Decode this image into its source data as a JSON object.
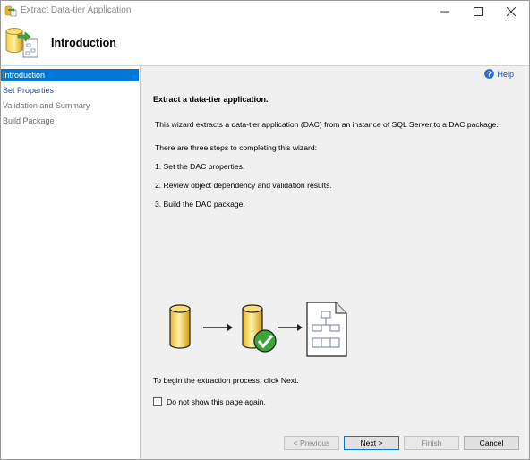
{
  "window": {
    "title": "Extract Data-tier Application"
  },
  "header": {
    "title": "Introduction"
  },
  "nav": {
    "items": [
      {
        "label": "Introduction"
      },
      {
        "label": "Set Properties"
      },
      {
        "label": "Validation and Summary"
      },
      {
        "label": "Build Package"
      }
    ]
  },
  "content": {
    "help_label": "Help",
    "heading": "Extract a data-tier application.",
    "description": "This wizard extracts a data-tier application (DAC) from an instance of SQL Server to a DAC package.",
    "steps_intro": "There are three steps to completing this wizard:",
    "steps": [
      "1. Set the DAC properties.",
      "2. Review object dependency and validation results.",
      "3. Build the DAC package."
    ],
    "begin_text": "To begin the extraction process, click Next.",
    "checkbox_label": "Do not show this page again."
  },
  "buttons": {
    "previous": "< Previous",
    "next": "Next >",
    "finish": "Finish",
    "cancel": "Cancel"
  },
  "colors": {
    "selection": "#0078d7",
    "link": "#1f4e9c",
    "panel": "#f0f0f0"
  }
}
